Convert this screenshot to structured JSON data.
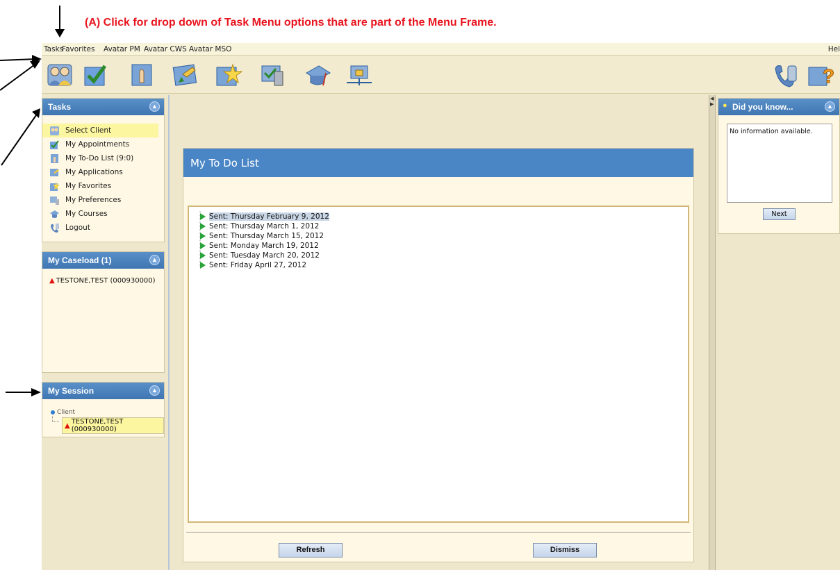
{
  "annotation": {
    "text": "(A) Click for drop down of Task Menu options that are part of the Menu Frame."
  },
  "menubar": {
    "items": [
      "Tasks",
      "Favorites",
      "Avatar PM",
      "Avatar CWS",
      "Avatar MSO"
    ],
    "help": "Hel"
  },
  "toolbar": {
    "icons": [
      "select-client-icon",
      "appointments-icon",
      "todo-list-icon",
      "applications-icon",
      "favorites-icon",
      "preferences-icon",
      "courses-icon",
      "network-icon",
      "logout-icon",
      "help-icon"
    ]
  },
  "tasks_panel": {
    "title": "Tasks",
    "items": [
      "Select Client",
      "My Appointments",
      "My To-Do List (9:0)",
      "My Applications",
      "My Favorites",
      "My Preferences",
      "My Courses",
      "Logout"
    ]
  },
  "caseload_panel": {
    "title": "My Caseload (1)",
    "client": "TESTONE,TEST (000930000)"
  },
  "session_panel": {
    "title": "My Session",
    "node_label": "Client",
    "client": "TESTONE,TEST (000930000)"
  },
  "todo": {
    "title": "My To Do List",
    "items": [
      "Sent: Thursday February 9, 2012",
      "Sent: Thursday March 1, 2012",
      "Sent: Thursday March 15, 2012",
      "Sent: Monday March 19, 2012",
      "Sent: Tuesday March 20, 2012",
      "Sent: Friday April 27, 2012"
    ],
    "refresh_label": "Refresh",
    "dismiss_label": "Dismiss"
  },
  "did_you_know": {
    "title": "Did you know...",
    "text": "No information available.",
    "next_label": "Next"
  },
  "colors": {
    "annotation_red": "#e8141e",
    "panel_header_blue": "#3f76b2",
    "app_background": "#efe7cc"
  }
}
